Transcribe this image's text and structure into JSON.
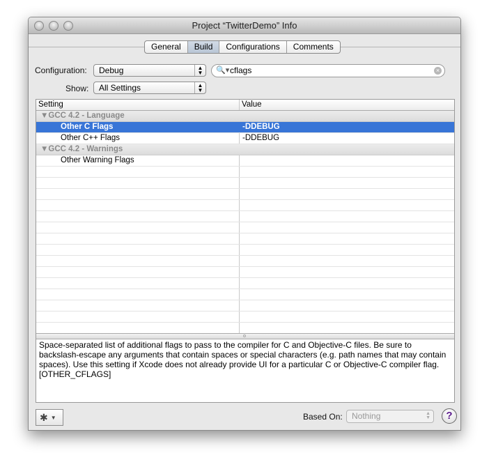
{
  "window": {
    "title": "Project “TwitterDemo” Info"
  },
  "tabs": [
    {
      "label": "General"
    },
    {
      "label": "Build",
      "selected": true
    },
    {
      "label": "Configurations"
    },
    {
      "label": "Comments"
    }
  ],
  "filters": {
    "configuration_label": "Configuration:",
    "configuration_value": "Debug",
    "show_label": "Show:",
    "show_value": "All Settings",
    "search_value": "cflags"
  },
  "table": {
    "headers": [
      "Setting",
      "Value"
    ],
    "groups": [
      {
        "title": "▼GCC 4.2 - Language",
        "rows": [
          {
            "setting": "Other C Flags",
            "value": "-DDEBUG"
          },
          {
            "setting": "Other C++ Flags",
            "value": "-DDEBUG"
          }
        ]
      },
      {
        "title": "▼GCC 4.2 - Warnings",
        "rows": [
          {
            "setting": "Other Warning Flags",
            "value": ""
          }
        ]
      }
    ]
  },
  "description": "Space-separated list of additional flags to pass to the compiler for C and Objective-C files.  Be sure to backslash-escape any arguments that contain spaces or special characters (e.g. path names that may contain spaces).  Use this setting if Xcode does not already provide UI for a particular C or Objective-C compiler flag. [OTHER_CFLAGS]",
  "footer": {
    "based_on_label": "Based On:",
    "based_on_value": "Nothing",
    "help_label": "?"
  },
  "colors": {
    "selection": "#3875d7",
    "help": "#5a1a8c"
  }
}
